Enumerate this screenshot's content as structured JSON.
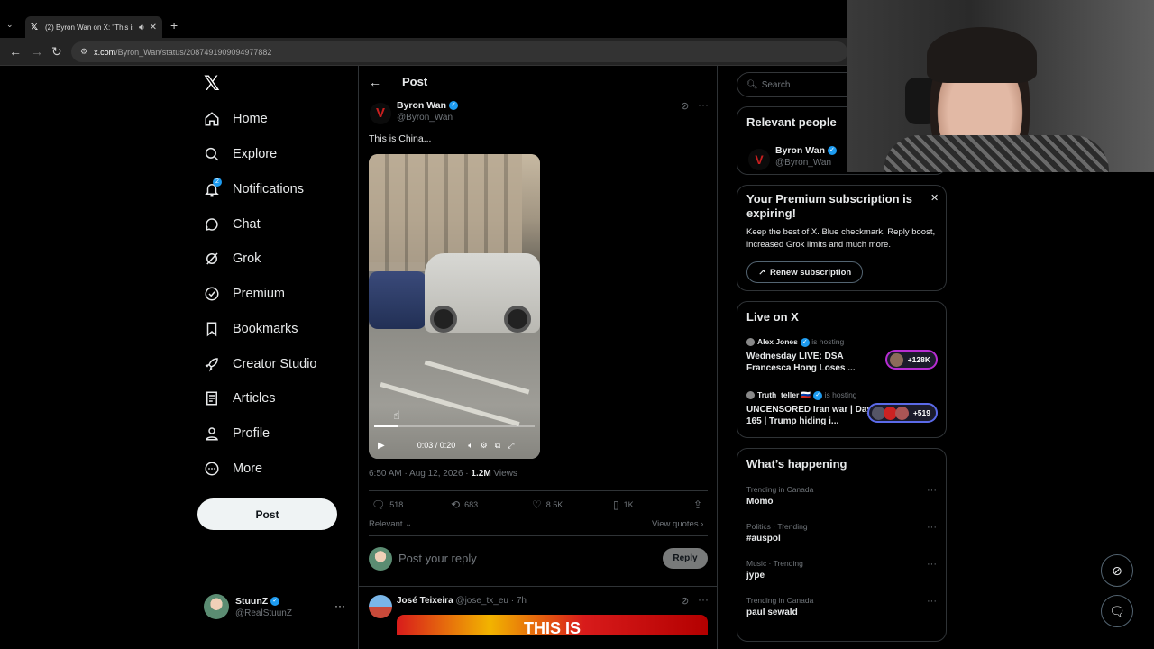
{
  "browser": {
    "tab_title": "(2) Byron Wan on X: \"This is",
    "url_host": "x.com",
    "url_path": "/Byron_Wan/status/2087491909094977882"
  },
  "nav": {
    "items": [
      {
        "label": "Home",
        "icon": "home-icon"
      },
      {
        "label": "Explore",
        "icon": "search-icon"
      },
      {
        "label": "Notifications",
        "icon": "bell-icon",
        "badge": "2"
      },
      {
        "label": "Chat",
        "icon": "chat-bubble-icon"
      },
      {
        "label": "Grok",
        "icon": "grok-icon"
      },
      {
        "label": "Premium",
        "icon": "premium-badge-icon"
      },
      {
        "label": "Bookmarks",
        "icon": "bookmark-icon"
      },
      {
        "label": "Creator Studio",
        "icon": "rocket-icon"
      },
      {
        "label": "Articles",
        "icon": "article-icon"
      },
      {
        "label": "Profile",
        "icon": "person-icon"
      },
      {
        "label": "More",
        "icon": "more-circle-icon"
      }
    ],
    "post_label": "Post",
    "account": {
      "name": "StuunZ",
      "handle": "@RealStuunZ"
    }
  },
  "post": {
    "header_title": "Post",
    "author_name": "Byron Wan",
    "author_handle": "@Byron_Wan",
    "text": "This is China...",
    "video_time": "0:03 / 0:20",
    "video_progress": 0.15,
    "timestamp": "6:50 AM · Aug 12, 2026 · ",
    "views_count": "1.2M",
    "views_label": " Views",
    "replies": "518",
    "reposts": "683",
    "likes": "8.5K",
    "bookmarks": "1K",
    "sort_label": "Relevant",
    "view_quotes": "View quotes",
    "reply_placeholder": "Post your reply",
    "reply_button": "Reply"
  },
  "reply": {
    "name": "José Teixeira",
    "handle": "@jose_tx_eu · 7h",
    "media_text": "THIS IS"
  },
  "sidebar": {
    "search_placeholder": "Search",
    "relevant": {
      "title": "Relevant people",
      "name": "Byron Wan",
      "handle": "@Byron_Wan"
    },
    "premium": {
      "title": "Your Premium subscription is expiring!",
      "body": "Keep the best of X. Blue checkmark, Reply boost, increased Grok limits and much more.",
      "button": "Renew subscription"
    },
    "live": {
      "title": "Live on X",
      "items": [
        {
          "host": "Alex Jones",
          "status": "is hosting",
          "title": "Wednesday LIVE: DSA Francesca Hong Loses ...",
          "count": "+128K"
        },
        {
          "host": "Truth_teller 🇷🇺",
          "status": "is hosting",
          "title": "UNCENSORED Iran war | Day 165 | Trump hiding i...",
          "count": "+519"
        }
      ]
    },
    "happening": {
      "title": "What’s happening",
      "items": [
        {
          "context": "Trending in Canada",
          "topic": "Momo"
        },
        {
          "context": "Politics · Trending",
          "topic": "#auspol"
        },
        {
          "context": "Music · Trending",
          "topic": "jype"
        },
        {
          "context": "Trending in Canada",
          "topic": "paul sewald"
        }
      ]
    }
  }
}
